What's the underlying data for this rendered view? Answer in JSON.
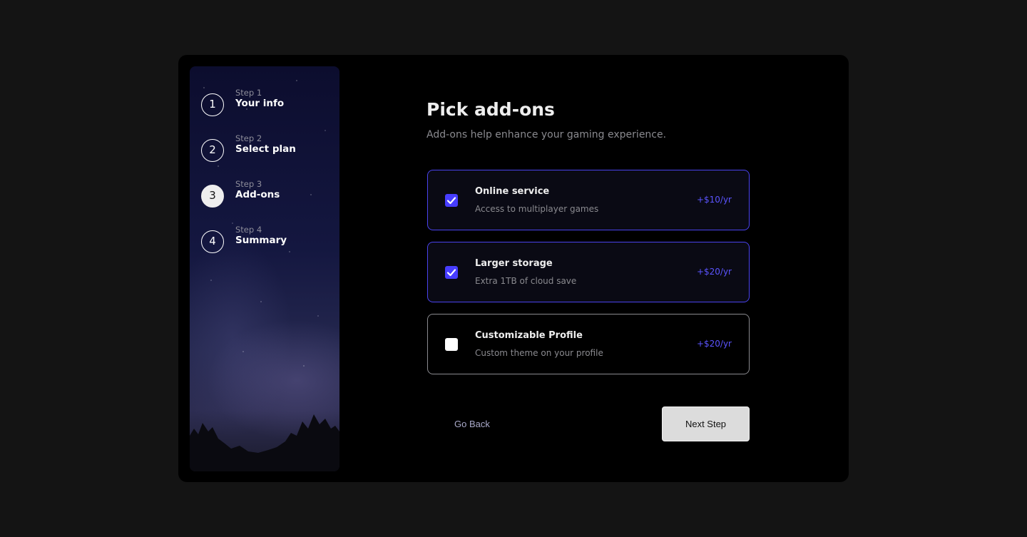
{
  "steps": [
    {
      "number": "1",
      "caption": "Step 1",
      "title": "Your info",
      "active": false
    },
    {
      "number": "2",
      "caption": "Step 2",
      "title": "Select plan",
      "active": false
    },
    {
      "number": "3",
      "caption": "Step 3",
      "title": "Add-ons",
      "active": true
    },
    {
      "number": "4",
      "caption": "Step 4",
      "title": "Summary",
      "active": false
    }
  ],
  "main": {
    "heading": "Pick add-ons",
    "subheading": "Add-ons help enhance your gaming experience."
  },
  "addons": [
    {
      "title": "Online service",
      "description": "Access to multiplayer games",
      "price": "+$10/yr",
      "checked": true
    },
    {
      "title": "Larger storage",
      "description": "Extra 1TB of cloud save",
      "price": "+$20/yr",
      "checked": true
    },
    {
      "title": "Customizable Profile",
      "description": "Custom theme on your profile",
      "price": "+$20/yr",
      "checked": false
    }
  ],
  "footer": {
    "back_label": "Go Back",
    "next_label": "Next Step"
  },
  "colors": {
    "accent": "#473dff",
    "price": "#5b54ff",
    "page_bg": "#141414",
    "card_bg": "#000000"
  },
  "icons": {
    "checkbox_checked": "checkmark-icon"
  }
}
